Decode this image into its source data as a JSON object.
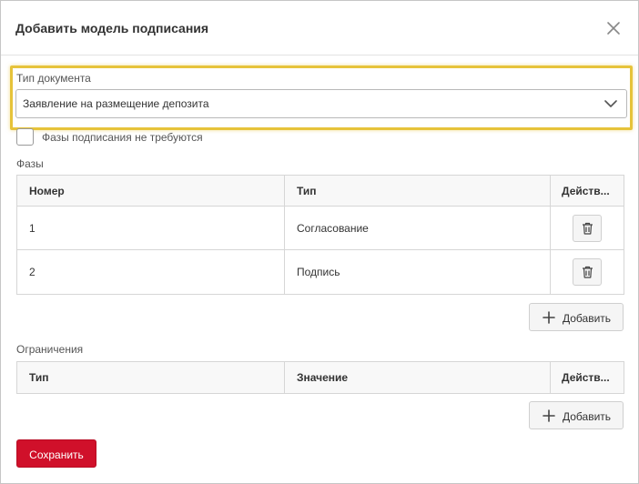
{
  "dialog": {
    "title": "Добавить модель подписания",
    "close_icon": "close-icon"
  },
  "document_type": {
    "label": "Тип документа",
    "selected_value": "Заявление на размещение депозита",
    "dropdown_icon": "chevron-down-icon",
    "highlight_color": "#e6c33a"
  },
  "no_phases_checkbox": {
    "label": "Фазы подписания не требуются",
    "checked": false
  },
  "phases": {
    "section_label": "Фазы",
    "columns": [
      "Номер",
      "Тип",
      "Действ..."
    ],
    "rows": [
      {
        "number": "1",
        "type": "Согласование",
        "action_icon": "trash-icon"
      },
      {
        "number": "2",
        "type": "Подпись",
        "action_icon": "trash-icon"
      }
    ],
    "add_label": "Добавить",
    "add_icon": "plus-icon"
  },
  "restrictions": {
    "section_label": "Ограничения",
    "columns": [
      "Тип",
      "Значение",
      "Действ..."
    ],
    "rows": [],
    "add_label": "Добавить",
    "add_icon": "plus-icon"
  },
  "footer": {
    "save_label": "Сохранить",
    "save_color": "#d0102a"
  }
}
